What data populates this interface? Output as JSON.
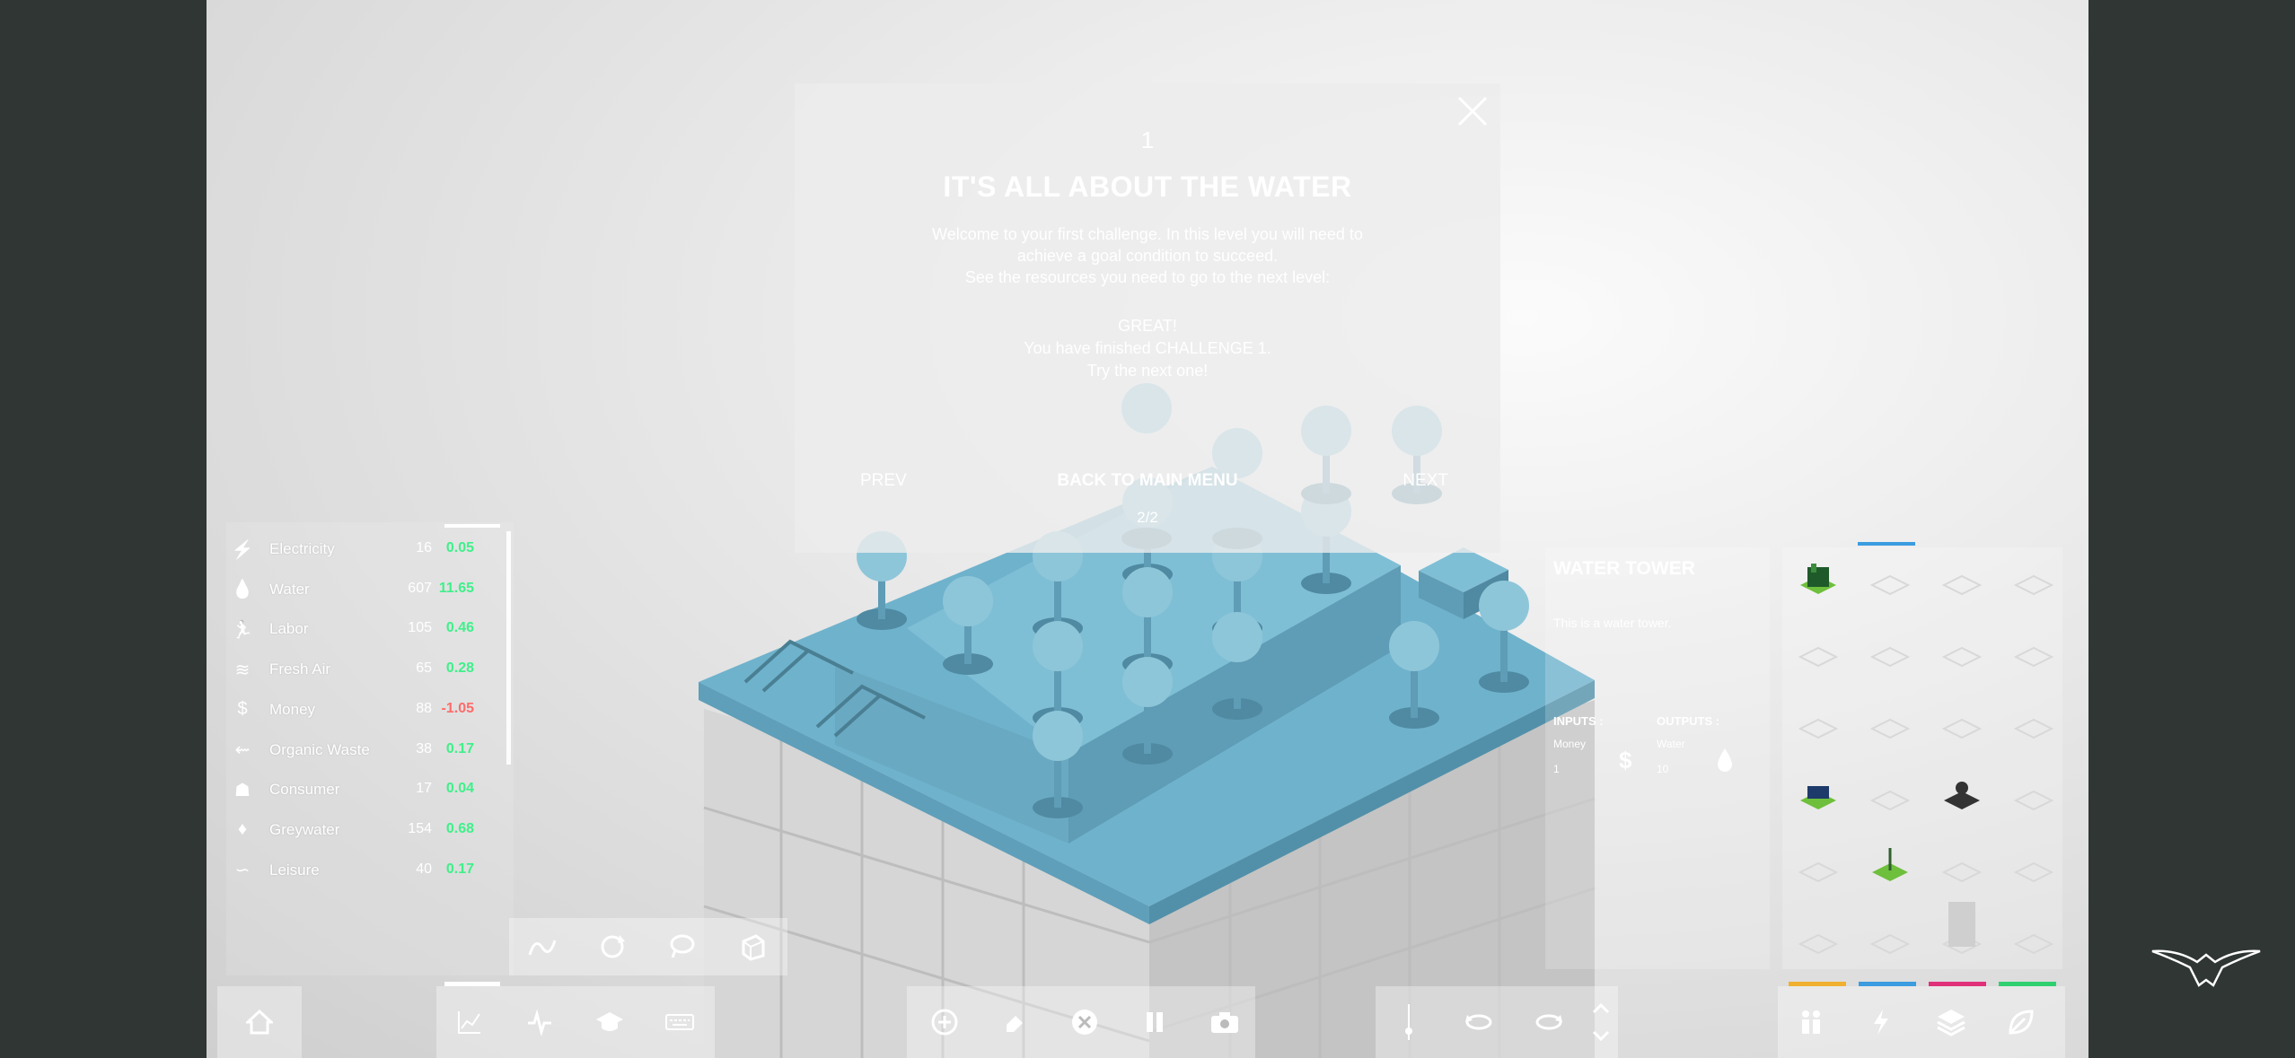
{
  "resources": [
    {
      "name": "Electricity",
      "count": "16",
      "rate": "0.05",
      "icon": "lightning-icon",
      "positive": true
    },
    {
      "name": "Water",
      "count": "607",
      "rate": "11.65",
      "icon": "water-drop-icon",
      "positive": true
    },
    {
      "name": "Labor",
      "count": "105",
      "rate": "0.46",
      "icon": "runner-icon",
      "positive": true
    },
    {
      "name": "Fresh Air",
      "count": "65",
      "rate": "0.28",
      "icon": "wind-icon",
      "positive": true
    },
    {
      "name": "Money",
      "count": "88",
      "rate": "-1.05",
      "icon": "dollar-icon",
      "positive": false
    },
    {
      "name": "Organic Waste",
      "count": "38",
      "rate": "0.17",
      "icon": "waste-icon",
      "positive": true
    },
    {
      "name": "Consumer",
      "count": "17",
      "rate": "0.04",
      "icon": "consumer-icon",
      "positive": true
    },
    {
      "name": "Greywater",
      "count": "154",
      "rate": "0.68",
      "icon": "greywater-icon",
      "positive": true
    },
    {
      "name": "Leisure",
      "count": "40",
      "rate": "0.17",
      "icon": "leisure-icon",
      "positive": true
    }
  ],
  "modal": {
    "number": "1",
    "title": "IT'S ALL ABOUT THE WATER",
    "body_line1": "Welcome to your first challenge. In this level you will need to",
    "body_line2": "achieve a goal condition to succeed.",
    "body_line3": "See the resources you need to go to the next level:",
    "great_line1": "GREAT!",
    "great_line2": "You have finished CHALLENGE 1.",
    "great_line3": "Try the next one!",
    "prev": "PREV",
    "back": "BACK TO MAIN MENU",
    "next": "NEXT",
    "page": "2/2"
  },
  "info": {
    "title": "WATER TOWER",
    "description": "This is a water tower.",
    "inputs_label": "INPUTS :",
    "outputs_label": "OUTPUTS :",
    "input_name": "Money",
    "input_value": "1",
    "output_name": "Water",
    "output_value": "10"
  },
  "colors": {
    "positive": "#3ff08a",
    "negative": "#ff6b6b",
    "water": "#6fb2cc",
    "tab_blue": "#3b9ce0",
    "tab_orange": "#f0b030",
    "tab_pink": "#e0307a",
    "tab_green": "#30d070"
  }
}
